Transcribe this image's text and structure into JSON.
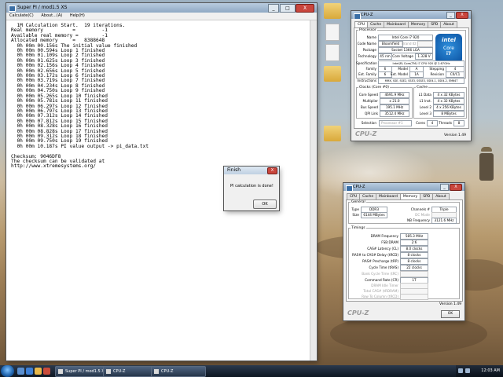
{
  "superpi": {
    "title": "Super PI / mod1.5 XS",
    "menu": [
      "Calculate(C)",
      "About...(A)",
      "Help(H)"
    ],
    "console": [
      "  1M Calculation Start.  19 iterations.",
      "Real memory          =         -1",
      "Available real memory =        -1",
      "Allocated memory     =   8388648",
      "  0h 00m 00.156s The initial value finished",
      "  0h 00m 00.594s Loop 1 finished",
      "  0h 00m 01.109s Loop 2 finished",
      "  0h 00m 01.625s Loop 3 finished",
      "  0h 00m 02.156s Loop 4 finished",
      "  0h 00m 02.656s Loop 5 finished",
      "  0h 00m 03.172s Loop 6 finished",
      "  0h 00m 03.719s Loop 7 finished",
      "  0h 00m 04.234s Loop 8 finished",
      "  0h 00m 04.750s Loop 9 finished",
      "  0h 00m 05.265s Loop 10 finished",
      "  0h 00m 05.781s Loop 11 finished",
      "  0h 00m 06.297s Loop 12 finished",
      "  0h 00m 06.797s Loop 13 finished",
      "  0h 00m 07.312s Loop 14 finished",
      "  0h 00m 07.812s Loop 15 finished",
      "  0h 00m 08.328s Loop 16 finished",
      "  0h 00m 08.828s Loop 17 finished",
      "  0h 00m 09.312s Loop 18 finished",
      "  0h 00m 09.750s Loop 19 finished",
      "  0h 00m 10.187s PI value output -> pi_data.txt",
      "",
      "Checksum: 9046DF8",
      "The checksum can be validated at",
      "http://www.xtremesystems.org/"
    ],
    "close": "X",
    "minimize": "_",
    "maximize": "□"
  },
  "finish": {
    "title": "Finish",
    "message": "PI calculation is done!",
    "ok": "OK",
    "close": "X"
  },
  "cpuz1": {
    "title": "CPU-Z",
    "tabs": [
      "CPU",
      "Cache",
      "Mainboard",
      "Memory",
      "SPD",
      "About"
    ],
    "active_tab": "CPU",
    "processor_legend": "Processor",
    "name_label": "Name",
    "name": "Intel Core i7 920",
    "codename_label": "Code Name",
    "codename": "Bloomfield",
    "brandid_label": "Brand ID",
    "package_label": "Package",
    "package": "Socket 1366 LGA",
    "technology_label": "Technology",
    "technology": "45 nm",
    "corevolt_label": "Core Voltage",
    "corevolt": "1.328 V",
    "spec_label": "Specification",
    "spec": "Intel(R) Core(TM) i7 CPU    920 @ 2.67GHz",
    "family_label": "Family",
    "family": "6",
    "model_label": "Model",
    "model": "A",
    "stepping_label": "Stepping",
    "stepping": "4",
    "extfamily_label": "Ext. Family",
    "extfamily": "6",
    "extmodel_label": "Ext. Model",
    "extmodel": "1A",
    "revision_label": "Revision",
    "revision": "C0/C1",
    "instr_label": "Instructions",
    "instr": "MMX, SSE, SSE2, SSE3, SSSE3, SSE4.1, SSE4.2, EM64T",
    "clocks_legend": "Clocks (Core #0)",
    "corespeed_label": "Core Speed",
    "corespeed": "4691.9 MHz",
    "multiplier_label": "Multiplier",
    "multiplier": "x 21.0",
    "busspeed_label": "Bus Speed",
    "busspeed": "195.1 MHz",
    "qpi_label": "QPI Link",
    "qpi": "3512.4 MHz",
    "cache_legend": "Cache",
    "l1d_label": "L1 Data",
    "l1d": "4 x 32 KBytes",
    "l1i_label": "L1 Inst.",
    "l1i": "4 x 32 KBytes",
    "l2_label": "Level 2",
    "l2": "4 x 256 KBytes",
    "l3_label": "Level 3",
    "l3": "8 MBytes",
    "selection_label": "Selection",
    "selection": "Processor #1",
    "cores_label": "Cores",
    "cores": "4",
    "threads_label": "Threads",
    "threads": "8",
    "brand": "CPU-Z",
    "version": "Version 1.49",
    "intel_logo": [
      "intel",
      "Core",
      "i7"
    ],
    "close": "X",
    "minimize": "_"
  },
  "cpuz2": {
    "title": "CPU-Z",
    "tabs": [
      "CPU",
      "Cache",
      "Mainboard",
      "Memory",
      "SPD",
      "About"
    ],
    "active_tab": "Memory",
    "general_legend": "General",
    "type_label": "Type",
    "type": "DDR3",
    "channels_label": "Channels #",
    "channels": "Triple",
    "size_label": "Size",
    "size": "6144 MBytes",
    "dcmode_label": "DC Mode",
    "nbfreq_label": "NB Frequency",
    "nbfreq": "3121.6 MHz",
    "timings_legend": "Timings",
    "dramfreq_label": "DRAM Frequency",
    "dramfreq": "585.3 MHz",
    "fsbdram_label": "FSB:DRAM",
    "fsbdram": "2:6",
    "cas_label": "CAS# Latency (CL)",
    "cas": "8.0 clocks",
    "rcd_label": "RAS# to CAS# Delay (tRCD)",
    "rcd": "8 clocks",
    "rp_label": "RAS# Precharge (tRP)",
    "rp": "8 clocks",
    "ras_label": "Cycle Time (tRAS)",
    "ras": "22 clocks",
    "rc_label": "Bank Cycle Time (tRC)",
    "cr_label": "Command Rate (CR)",
    "cr": "1T",
    "idle_label": "DRAM Idle Timer",
    "rdram_label": "Total CAS# (tRDRAM)",
    "trcd2_label": "Row To Column (tRCD)",
    "brand": "CPU-Z",
    "version": "Version 1.49",
    "ok": "OK",
    "close": "X",
    "minimize": "_"
  },
  "taskbar": {
    "items": [
      "Super PI / mod1.5 XS",
      "CPU-Z",
      "CPU-Z"
    ],
    "clock": "12:03 AM"
  }
}
